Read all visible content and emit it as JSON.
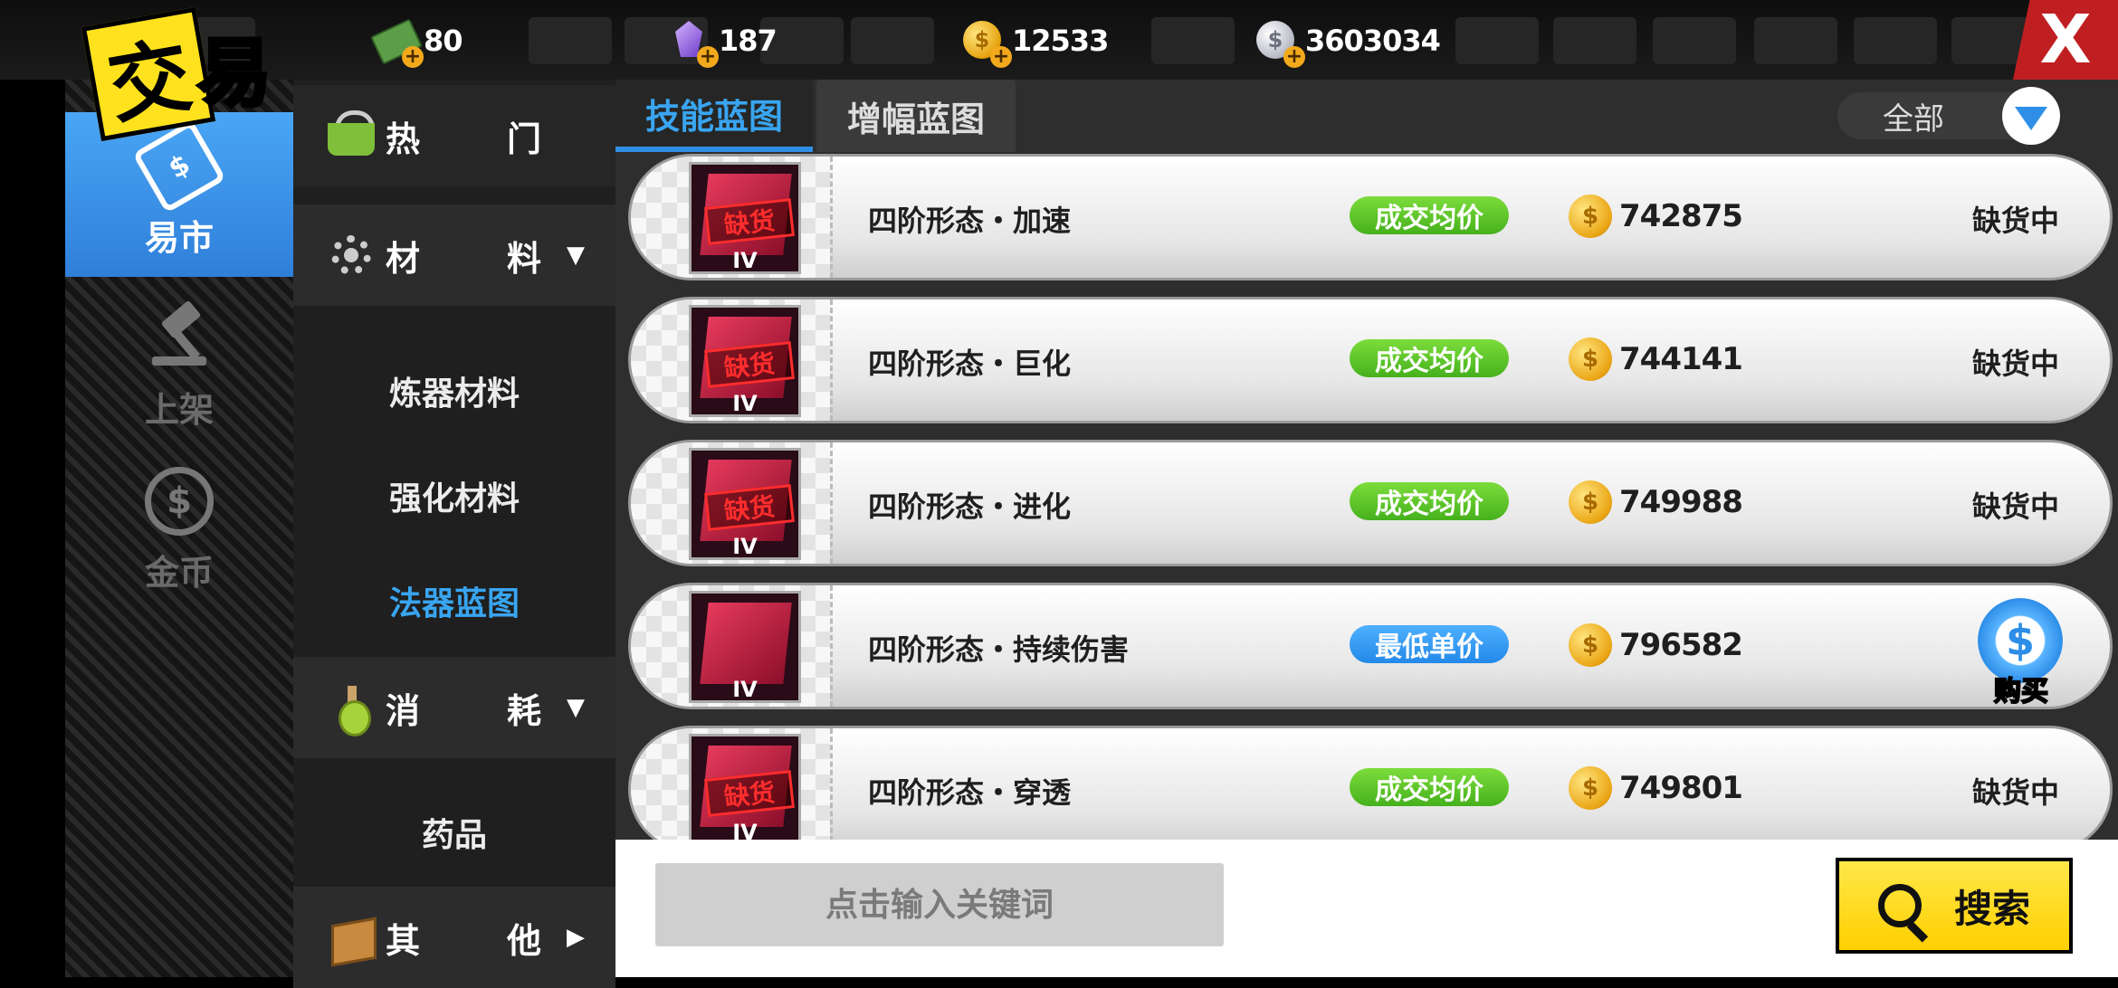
{
  "header": {
    "logo_char1": "交",
    "logo_char2": "易",
    "close_label": "X",
    "currencies": [
      {
        "name": "cash",
        "value": "80"
      },
      {
        "name": "diamond",
        "value": "187"
      },
      {
        "name": "gold-coin",
        "value": "12533"
      },
      {
        "name": "silver-coin",
        "value": "3603034"
      }
    ]
  },
  "leftnav": {
    "items": [
      {
        "label": "易市",
        "icon": "price-tag-icon",
        "active": true
      },
      {
        "label": "上架",
        "icon": "auction-hammer-icon",
        "active": false
      },
      {
        "label": "金币",
        "icon": "coin-icon",
        "active": false
      }
    ]
  },
  "categories": {
    "hot": {
      "label1": "热",
      "label2": "门"
    },
    "materials": {
      "label1": "材",
      "label2": "料",
      "arrow": "▼"
    },
    "materials_sub": [
      "炼器材料",
      "强化材料",
      "法器蓝图"
    ],
    "consumables": {
      "label1": "消",
      "label2": "耗",
      "arrow": "▼"
    },
    "consumables_sub": [
      "药品"
    ],
    "others": {
      "label1": "其",
      "label2": "他",
      "arrow": "▶"
    }
  },
  "tabs": [
    {
      "label": "技能蓝图",
      "active": true
    },
    {
      "label": "增幅蓝图",
      "active": false
    }
  ],
  "filter": {
    "label": "全部"
  },
  "items": [
    {
      "rank": "IV",
      "stamp": "缺货",
      "name": "四阶形态・加速",
      "badge": "成交均价",
      "badge_color": "green",
      "price": "742875",
      "status": "缺货中"
    },
    {
      "rank": "IV",
      "stamp": "缺货",
      "name": "四阶形态・巨化",
      "badge": "成交均价",
      "badge_color": "green",
      "price": "744141",
      "status": "缺货中"
    },
    {
      "rank": "IV",
      "stamp": "缺货",
      "name": "四阶形态・进化",
      "badge": "成交均价",
      "badge_color": "green",
      "price": "749988",
      "status": "缺货中"
    },
    {
      "rank": "IV",
      "stamp": "",
      "name": "四阶形态・持续伤害",
      "badge": "最低单价",
      "badge_color": "blue",
      "price": "796582",
      "buy_label": "购买"
    },
    {
      "rank": "IV",
      "stamp": "缺货",
      "name": "四阶形态・穿透",
      "badge": "成交均价",
      "badge_color": "green",
      "price": "749801",
      "status": "缺货中"
    }
  ],
  "search": {
    "placeholder": "点击输入关键词",
    "button_label": "搜索"
  },
  "colors": {
    "accent_blue": "#39a5f0",
    "badge_green": "#46b11d",
    "badge_blue": "#2389e8",
    "search_yellow": "#ffcf00",
    "close_red": "#c01f22"
  }
}
